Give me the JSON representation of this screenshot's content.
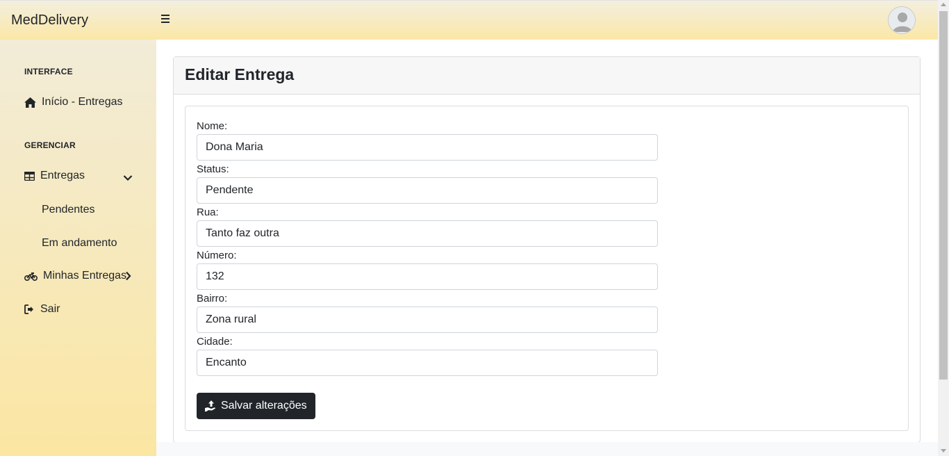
{
  "app": {
    "brand": "MedDelivery"
  },
  "topbar": {
    "menu_icon": "bars-icon",
    "avatar_icon": "user-avatar-icon"
  },
  "sidebar": {
    "heading_interface": "INTERFACE",
    "home": {
      "label": "Início - Entregas",
      "icon": "home-icon"
    },
    "heading_manage": "GERENCIAR",
    "entregas": {
      "label": "Entregas",
      "icon": "table-icon",
      "chevron": "chevron-down-icon"
    },
    "sub_items": [
      "Pendentes",
      "Em andamento"
    ],
    "my_deliveries": {
      "label": "Minhas Entregas",
      "icon": "motorcycle-icon",
      "chevron": "chevron-right-icon"
    },
    "logout": {
      "label": "Sair",
      "icon": "sign-out-icon"
    }
  },
  "page": {
    "title": "Editar Entrega",
    "fields": [
      {
        "label": "Nome:",
        "value": "Dona Maria"
      },
      {
        "label": "Status:",
        "value": "Pendente"
      },
      {
        "label": "Rua:",
        "value": "Tanto faz outra"
      },
      {
        "label": "Número:",
        "value": "132"
      },
      {
        "label": "Bairro:",
        "value": "Zona rural"
      },
      {
        "label": "Cidade:",
        "value": "Encanto"
      }
    ],
    "save_button": {
      "label": "Salvar alterações",
      "icon": "hand-holding-upload-icon"
    }
  },
  "colors": {
    "topbar_bg": "#fbe7a6",
    "sidebar_bg": "#fbe6a2",
    "button_bg": "#212529"
  }
}
